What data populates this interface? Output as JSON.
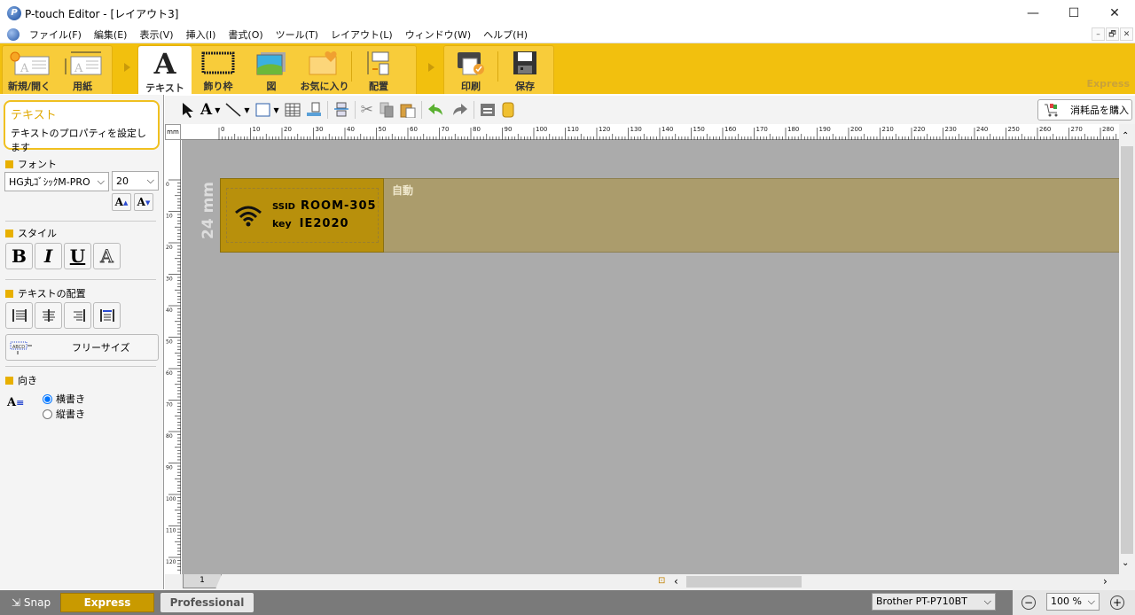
{
  "window": {
    "title": "P-touch Editor - [レイアウト3]",
    "controls": {
      "minimize": "—",
      "maximize": "☐",
      "close": "✕"
    },
    "mdi_controls": {
      "minimize": "–",
      "restore": "🗗",
      "close": "✕"
    }
  },
  "menu": [
    "ファイル(F)",
    "編集(E)",
    "表示(V)",
    "挿入(I)",
    "書式(O)",
    "ツール(T)",
    "レイアウト(L)",
    "ウィンドウ(W)",
    "ヘルプ(H)"
  ],
  "ribbon": {
    "groups": [
      {
        "buttons": [
          {
            "label": "新規/開く",
            "icon": "new-open-icon"
          },
          {
            "label": "用紙",
            "icon": "paper-icon"
          }
        ]
      },
      {
        "buttons": [
          {
            "label": "テキスト",
            "icon": "text-icon",
            "active": true
          },
          {
            "label": "飾り枠",
            "icon": "frame-icon"
          },
          {
            "label": "図",
            "icon": "image-icon"
          },
          {
            "label": "お気に入り",
            "icon": "favorites-icon"
          },
          {
            "label": "配置",
            "icon": "arrange-icon"
          }
        ]
      },
      {
        "buttons": [
          {
            "label": "印刷",
            "icon": "print-icon"
          },
          {
            "label": "保存",
            "icon": "save-icon"
          }
        ]
      }
    ],
    "mode_tag": "Express",
    "accent": "#f2c00e"
  },
  "left_panel": {
    "info_title": "テキスト",
    "info_desc": "テキストのプロパティを設定します",
    "font_section": "フォント",
    "font_name": "HG丸ｺﾞｼｯｸM-PRO",
    "font_size": "20",
    "grow_label": "A",
    "shrink_label": "A",
    "style_section": "スタイル",
    "style_buttons": [
      "B",
      "I",
      "U",
      "A"
    ],
    "align_section": "テキストの配置",
    "free_size_label": "フリーサイズ",
    "direction_section": "向き",
    "direction_options": [
      {
        "label": "横書き",
        "selected": true
      },
      {
        "label": "縦書き",
        "selected": false
      }
    ]
  },
  "toolbar": {
    "buy_supplies": "消耗品を購入"
  },
  "ruler": {
    "unit": "mm",
    "h_ticks": [
      "0",
      "10",
      "20",
      "30",
      "40",
      "50",
      "60",
      "70",
      "80",
      "90",
      "100",
      "110",
      "120",
      "130",
      "140",
      "150",
      "160",
      "170",
      "180",
      "190",
      "200",
      "210",
      "220",
      "230",
      "240",
      "250",
      "260",
      "270",
      "280"
    ],
    "v_ticks": [
      "0",
      "10",
      "20",
      "30",
      "40",
      "50",
      "60",
      "70",
      "80",
      "90",
      "100",
      "110",
      "120"
    ]
  },
  "label": {
    "tape_width": "24 mm",
    "ssid_key": "SSID",
    "ssid_value": "ROOM-305",
    "key_key": "key",
    "key_value": "IE2020",
    "length_mode": "自動",
    "label_color": "#b8900c"
  },
  "page_tab": "1",
  "status": {
    "snap": "Snap",
    "modes": [
      "Express",
      "Professional"
    ],
    "active_mode": "Express",
    "printer": "Brother PT-P710BT",
    "zoom": "100 %"
  }
}
